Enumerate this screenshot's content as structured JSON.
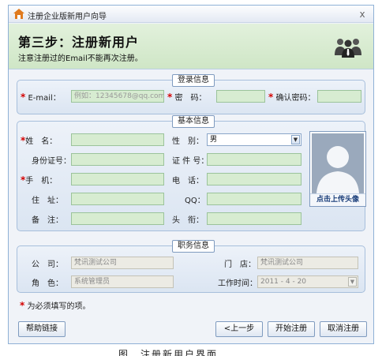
{
  "window": {
    "title": "注册企业版新用户向导",
    "close_glyph": "x"
  },
  "banner": {
    "step_title": "第三步：注册新用户",
    "note": "注意注册过的Email不能再次注册。"
  },
  "login_section": {
    "legend": "登录信息",
    "email_label": "E-mail：",
    "email_placeholder": "例如：12345678@qq.com",
    "password_label": "密　码：",
    "confirm_label": "确认密码："
  },
  "basic_section": {
    "legend": "基本信息",
    "name_label": "姓　名：",
    "gender_label": "性　别：",
    "gender_value": "男",
    "id_label": "身份证号：",
    "cert_label": "证 件 号：",
    "phone_label": "手　机：",
    "tel_label": "电　话：",
    "address_label": "住　址：",
    "qq_label": "QQ：",
    "remark_label": "备　注：",
    "title_label": "头　衔：",
    "upload_photo": "点击上传头像"
  },
  "job_section": {
    "legend": "职务信息",
    "company_label": "公　司：",
    "company_value": "梵讯测试公司",
    "store_label": "门　店：",
    "store_value": "梵讯测试公司",
    "role_label": "角　色：",
    "role_value": "系统管理员",
    "worktime_label": "工作时间：",
    "worktime_value": "2011 - 4 - 20"
  },
  "required_star": "*",
  "required_note": "为必须填写的项。",
  "buttons": {
    "help": "帮助链接",
    "prev": "<上一步",
    "start": "开始注册",
    "cancel": "取消注册"
  },
  "caption": "图　注册新用户界面",
  "colors": {
    "banner_green": "#d9ecd2",
    "field_green": "#d7ecd1",
    "required_red": "#d40000",
    "section_blue": "#dbe5f2"
  }
}
